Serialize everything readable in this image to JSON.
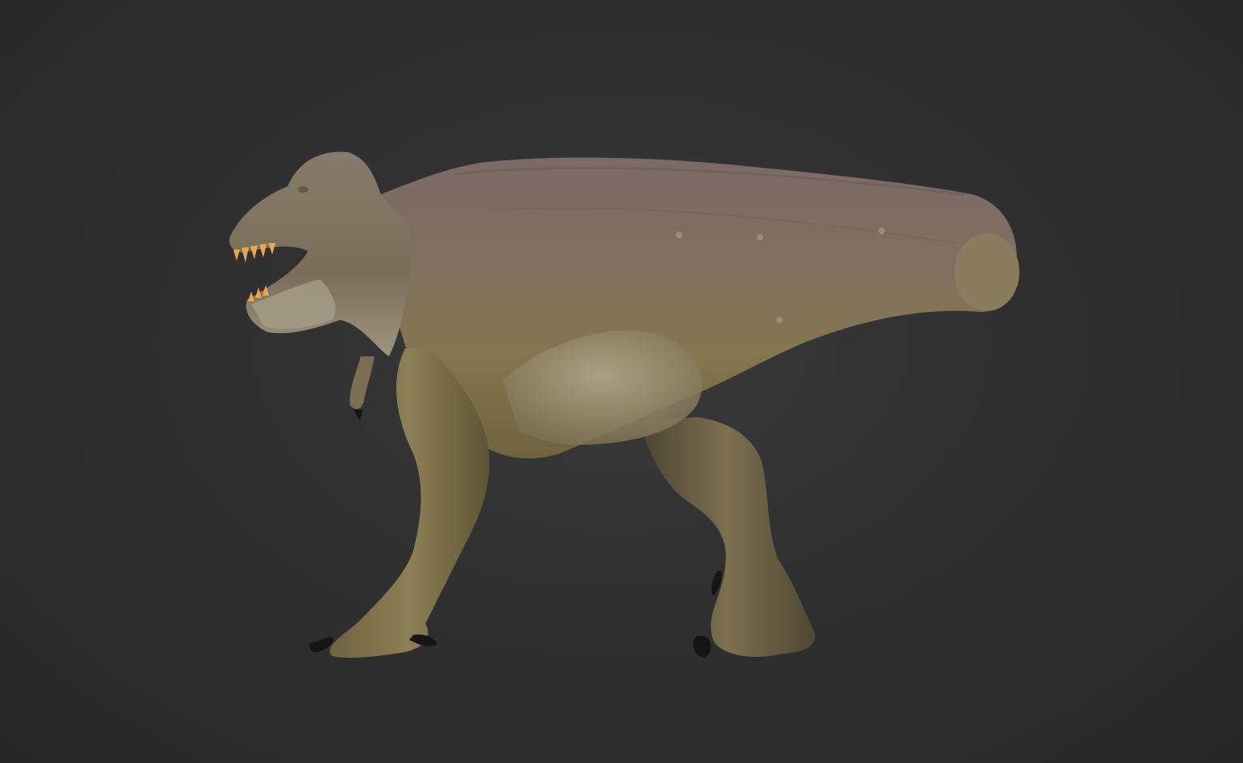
{
  "viewport": {
    "background_color": "#2e2e2f",
    "subject": "t-rex-sculpt"
  },
  "model": {
    "skin_color_top": "#7d6a66",
    "skin_color_mid": "#8a7b5c",
    "skin_color_belly": "#a89c82",
    "teeth_color": "#e9a84f",
    "claw_color": "#151515"
  }
}
